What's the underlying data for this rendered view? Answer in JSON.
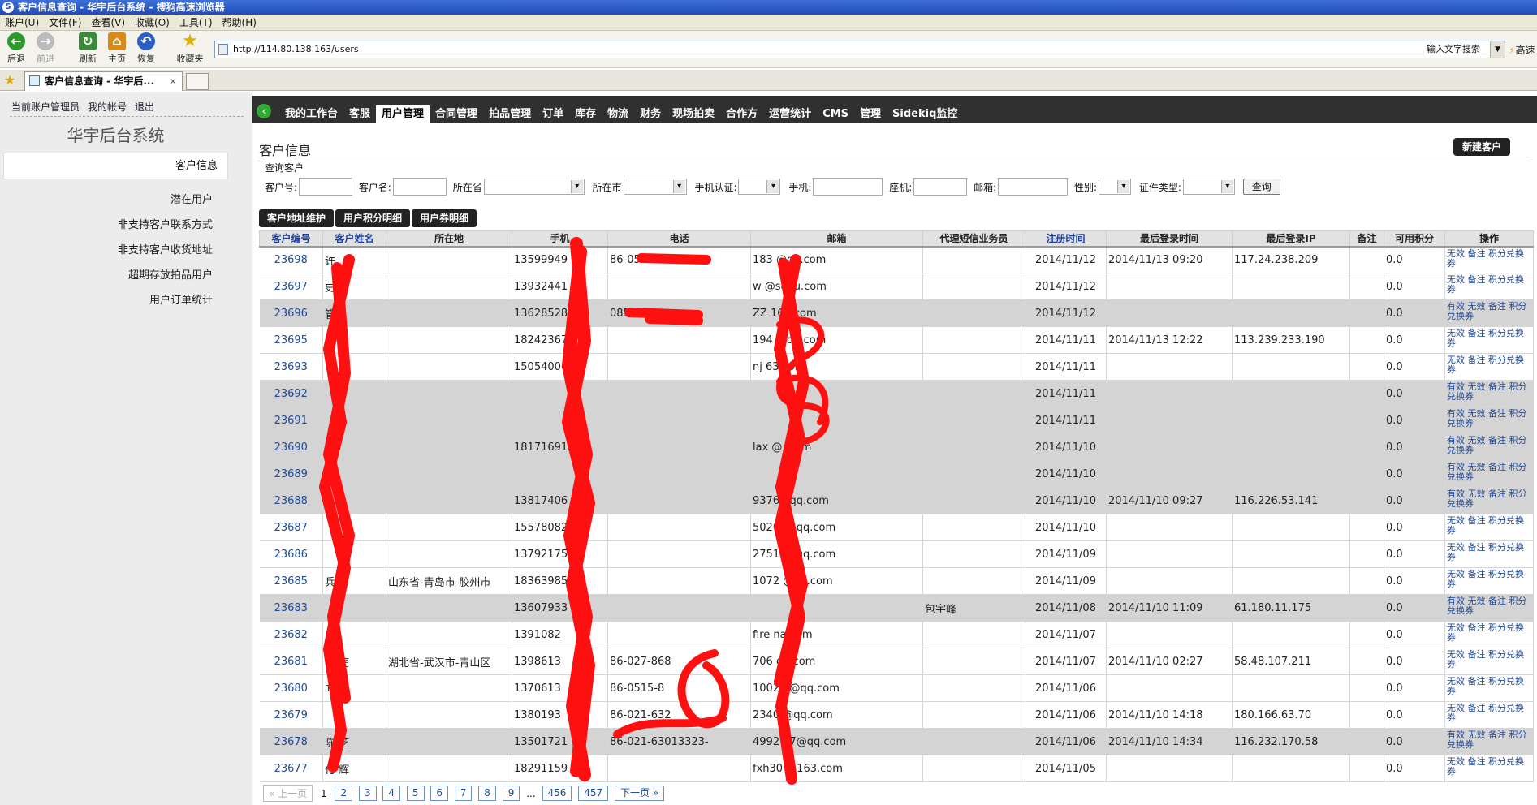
{
  "browser": {
    "title": "客户信息查询 - 华宇后台系统 - 搜狗高速浏览器",
    "menu": [
      "账户(U)",
      "文件(F)",
      "查看(V)",
      "收藏(O)",
      "工具(T)",
      "帮助(H)"
    ],
    "toolbar": {
      "back": "后退",
      "forward": "前进",
      "refresh": "刷新",
      "home": "主页",
      "restore": "恢复",
      "favorites": "收藏夹"
    },
    "url": "http://114.80.138.163/users",
    "search_label": "输入文字搜索",
    "speed_label": "高速",
    "tab_title": "客户信息查询 - 华宇后..."
  },
  "sidebar": {
    "account": [
      "当前账户管理员",
      "我的帐号",
      "退出"
    ],
    "system_title": "华宇后台系统",
    "current": "客户信息",
    "links": [
      "潜在用户",
      "非支持客户联系方式",
      "非支持客户收货地址",
      "超期存放拍品用户",
      "用户订单统计"
    ]
  },
  "nav": {
    "items": [
      "我的工作台",
      "客服",
      "用户管理",
      "合同管理",
      "拍品管理",
      "订单",
      "库存",
      "物流",
      "财务",
      "现场拍卖",
      "合作方",
      "运营统计",
      "CMS",
      "管理",
      "Sidekiq监控"
    ],
    "active": "用户管理"
  },
  "page": {
    "title": "客户信息",
    "new_button": "新建客户",
    "query_legend": "查询客户",
    "query_labels": {
      "id": "客户号:",
      "name": "客户名:",
      "province": "所在省",
      "city": "所在市",
      "phone_auth": "手机认证:",
      "mobile": "手机:",
      "landline": "座机:",
      "email": "邮箱:",
      "gender": "性别:",
      "id_type": "证件类型:"
    },
    "query_button": "查询",
    "sub_buttons": [
      "客户地址维护",
      "用户积分明细",
      "用户券明细"
    ]
  },
  "table": {
    "headers": [
      "客户编号",
      "客户姓名",
      "所在地",
      "手机",
      "电话",
      "邮箱",
      "代理短信业务员",
      "注册时间",
      "最后登录时间",
      "最后登录IP",
      "备注",
      "可用积分",
      "操作"
    ],
    "rows": [
      {
        "id": "23698",
        "name": "许",
        "loc": "",
        "mobile": "13599949",
        "tel": "86-0595-",
        "email": "183   @qq.com",
        "agent": "",
        "reg": "2014/11/12",
        "last": "2014/11/13 09:20",
        "ip": "117.24.238.209",
        "pts": "0.0",
        "ops": "无效 备注 积分兑换券",
        "gray": false
      },
      {
        "id": "23697",
        "name": "史",
        "loc": "",
        "mobile": "13932441",
        "tel": "",
        "email": "w       @sohu.com",
        "agent": "",
        "reg": "2014/11/12",
        "last": "",
        "ip": "",
        "pts": "0.0",
        "ops": "无效 备注 积分兑换券",
        "gray": false
      },
      {
        "id": "23696",
        "name": "管",
        "loc": "",
        "mobile": "13628528",
        "tel": "085",
        "email": "ZZ      163.com",
        "agent": "",
        "reg": "2014/11/12",
        "last": "",
        "ip": "",
        "pts": "0.0",
        "ops": "有效 无效 备注 积分兑换券",
        "gray": true
      },
      {
        "id": "23695",
        "name": "董",
        "loc": "",
        "mobile": "18242367",
        "tel": "",
        "email": "194     @qq.com",
        "agent": "",
        "reg": "2014/11/11",
        "last": "2014/11/13 12:22",
        "ip": "113.239.233.190",
        "pts": "0.0",
        "ops": "无效 备注 积分兑换券",
        "gray": false
      },
      {
        "id": "23693",
        "name": "",
        "loc": "",
        "mobile": "15054006",
        "tel": "",
        "email": "nj      63.com",
        "agent": "",
        "reg": "2014/11/11",
        "last": "",
        "ip": "",
        "pts": "0.0",
        "ops": "无效 备注 积分兑换券",
        "gray": false
      },
      {
        "id": "23692",
        "name": "",
        "loc": "",
        "mobile": "",
        "tel": "",
        "email": "",
        "agent": "",
        "reg": "2014/11/11",
        "last": "",
        "ip": "",
        "pts": "0.0",
        "ops": "有效 无效 备注 积分兑换券",
        "gray": true
      },
      {
        "id": "23691",
        "name": "",
        "loc": "",
        "mobile": "",
        "tel": "",
        "email": "",
        "agent": "",
        "reg": "2014/11/11",
        "last": "",
        "ip": "",
        "pts": "0.0",
        "ops": "有效 无效 备注 积分兑换券",
        "gray": true
      },
      {
        "id": "23690",
        "name": "",
        "loc": "",
        "mobile": "18171691",
        "tel": "",
        "email": "lax     @   .com",
        "agent": "",
        "reg": "2014/11/10",
        "last": "",
        "ip": "",
        "pts": "0.0",
        "ops": "有效 无效 备注 积分兑换券",
        "gray": true
      },
      {
        "id": "23689",
        "name": "",
        "loc": "",
        "mobile": "",
        "tel": "",
        "email": "",
        "agent": "",
        "reg": "2014/11/10",
        "last": "",
        "ip": "",
        "pts": "0.0",
        "ops": "有效 无效 备注 积分兑换券",
        "gray": true
      },
      {
        "id": "23688",
        "name": "",
        "loc": "",
        "mobile": "13817406",
        "tel": "",
        "email": "93764      qq.com",
        "agent": "",
        "reg": "2014/11/10",
        "last": "2014/11/10 09:27",
        "ip": "116.226.53.141",
        "pts": "0.0",
        "ops": "有效 无效 备注 积分兑换券",
        "gray": true
      },
      {
        "id": "23687",
        "name": "",
        "loc": "",
        "mobile": "15578082",
        "tel": "",
        "email": "502068    qq.com",
        "agent": "",
        "reg": "2014/11/10",
        "last": "",
        "ip": "",
        "pts": "0.0",
        "ops": "无效 备注 积分兑换券",
        "gray": false
      },
      {
        "id": "23686",
        "name": "",
        "loc": "",
        "mobile": "13792175",
        "tel": "",
        "email": "275145    qq.com",
        "agent": "",
        "reg": "2014/11/09",
        "last": "",
        "ip": "",
        "pts": "0.0",
        "ops": "无效 备注 积分兑换券",
        "gray": false
      },
      {
        "id": "23685",
        "name": "兵",
        "loc": "山东省-青岛市-胶州市",
        "mobile": "18363985",
        "tel": "",
        "email": "1072    @qq.com",
        "agent": "",
        "reg": "2014/11/09",
        "last": "",
        "ip": "",
        "pts": "0.0",
        "ops": "无效 备注 积分兑换券",
        "gray": false
      },
      {
        "id": "23683",
        "name": "",
        "loc": "",
        "mobile": "13607933",
        "tel": "",
        "email": "",
        "agent": "包宇峰",
        "reg": "2014/11/08",
        "last": "2014/11/10 11:09",
        "ip": "61.180.11.175",
        "pts": "0.0",
        "ops": "有效 无效 备注 积分兑换券",
        "gray": true
      },
      {
        "id": "23682",
        "name": "肖",
        "loc": "",
        "mobile": "1391082",
        "tel": "",
        "email": "fire    na.com",
        "agent": "",
        "reg": "2014/11/07",
        "last": "",
        "ip": "",
        "pts": "0.0",
        "ops": "无效 备注 积分兑换券",
        "gray": false
      },
      {
        "id": "23681",
        "name": "马  亮",
        "loc": "湖北省-武汉市-青山区",
        "mobile": "1398613",
        "tel": "86-027-868",
        "email": "706     qq.com",
        "agent": "",
        "reg": "2014/11/07",
        "last": "2014/11/10 02:27",
        "ip": "58.48.107.211",
        "pts": "0.0",
        "ops": "无效 备注 积分兑换券",
        "gray": false
      },
      {
        "id": "23680",
        "name": "叶  谦",
        "loc": "",
        "mobile": "1370613",
        "tel": "86-0515-8",
        "email": "1002    2@qq.com",
        "agent": "",
        "reg": "2014/11/06",
        "last": "",
        "ip": "",
        "pts": "0.0",
        "ops": "无效 备注 积分兑换券",
        "gray": false
      },
      {
        "id": "23679",
        "name": "",
        "loc": "",
        "mobile": "1380193",
        "tel": "86-021-632",
        "email": "2340    @qq.com",
        "agent": "",
        "reg": "2014/11/06",
        "last": "2014/11/10 14:18",
        "ip": "180.166.63.70",
        "pts": "0.0",
        "ops": "无效 备注 积分兑换券",
        "gray": false
      },
      {
        "id": "23678",
        "name": "陈  芝",
        "loc": "",
        "mobile": "13501721",
        "tel": "86-021-63013323-",
        "email": "4992   17@qq.com",
        "agent": "",
        "reg": "2014/11/06",
        "last": "2014/11/10 14:34",
        "ip": "116.232.170.58",
        "pts": "0.0",
        "ops": "有效 无效 备注 积分兑换券",
        "gray": true
      },
      {
        "id": "23677",
        "name": "付  辉",
        "loc": "",
        "mobile": "18291159",
        "tel": "",
        "email": "fxh30  @163.com",
        "agent": "",
        "reg": "2014/11/05",
        "last": "",
        "ip": "",
        "pts": "0.0",
        "ops": "无效 备注 积分兑换券",
        "gray": false
      }
    ]
  },
  "pager": {
    "prev": "« 上一页",
    "current": "1",
    "pages": [
      "2",
      "3",
      "4",
      "5",
      "6",
      "7",
      "8",
      "9"
    ],
    "ellipsis": "...",
    "tail": [
      "456",
      "457"
    ],
    "next": "下一页 »"
  },
  "colors": {
    "nav_bg": "#303030",
    "row_gray": "#d4d4d4",
    "link": "#224b95",
    "scribble": "#ff0000"
  }
}
